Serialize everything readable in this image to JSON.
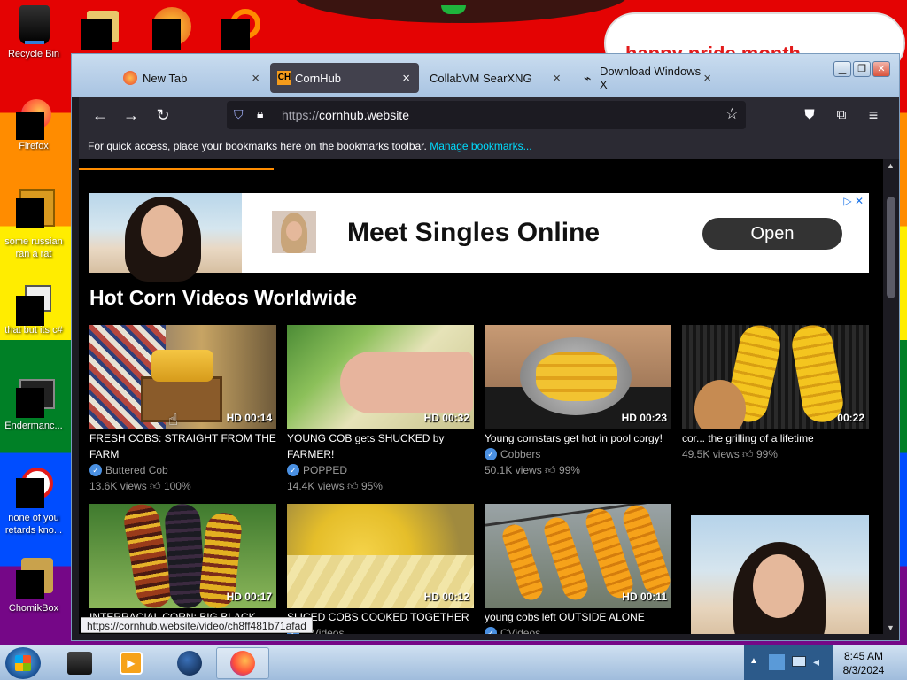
{
  "desktop": {
    "banner_text": "happy pride month",
    "icons": [
      {
        "label": "Recycle Bin"
      },
      {
        "label": "Firefox"
      },
      {
        "label": "some russian ran a rat"
      },
      {
        "label": "that but its c#"
      },
      {
        "label": "Endermanc..."
      },
      {
        "label": "none of you retards kno..."
      },
      {
        "label": "ChomikBox"
      }
    ]
  },
  "browser": {
    "tabs": [
      {
        "label": "New Tab",
        "close": "×"
      },
      {
        "label": "CornHub",
        "close": "×"
      },
      {
        "label": "CollabVM SearXNG",
        "close": "×"
      },
      {
        "label": "Download Windows X",
        "close": "×"
      }
    ],
    "url_prefix": "https://",
    "url_host": "cornhub.website",
    "bookmarks_hint": "For quick access, place your bookmarks here on the bookmarks toolbar.",
    "manage_bookmarks": "Manage bookmarks..."
  },
  "ad": {
    "title": "Meet Singles Online",
    "button": "Open",
    "adchoices": "▷ ✕"
  },
  "page": {
    "section_title": "Hot Corn Videos Worldwide",
    "videos": [
      {
        "duration": "HD 00:14",
        "title": "FRESH COBS: STRAIGHT FROM THE FARM",
        "channel": "Buttered Cob",
        "views": "13.6K views",
        "rating": "100%"
      },
      {
        "duration": "HD 00:32",
        "title": "YOUNG COB gets SHUCKED by FARMER!",
        "channel": "POPPED",
        "views": "14.4K views",
        "rating": "95%"
      },
      {
        "duration": "HD 00:23",
        "title": "Young cornstars get hot in pool corgy!",
        "channel": "Cobbers",
        "views": "50.1K views",
        "rating": "99%"
      },
      {
        "duration": "00:22",
        "title": "cor... the grilling of a lifetime",
        "channel": "",
        "views": "49.5K views",
        "rating": "99%"
      },
      {
        "duration": "HD 00:17",
        "title": "INTERRACIAL CORN: BIG BLACK",
        "channel": "",
        "views": "",
        "rating": ""
      },
      {
        "duration": "HD 00:12",
        "title": "SLICED COBS COOKED TOGETHER",
        "channel": "...Videos",
        "views": "",
        "rating": ""
      },
      {
        "duration": "HD 00:11",
        "title": "young cobs left OUTSIDE ALONE",
        "channel": "CVideos",
        "views": "",
        "rating": ""
      }
    ],
    "status_url": "https://cornhub.website/video/ch8ff481b71afad"
  },
  "taskbar": {
    "time": "8:45 AM",
    "date": "8/3/2024"
  },
  "colors": {
    "accent_orange": "#ff8c00",
    "verified_blue": "#4a90e2",
    "link_cyan": "#00ddff"
  }
}
